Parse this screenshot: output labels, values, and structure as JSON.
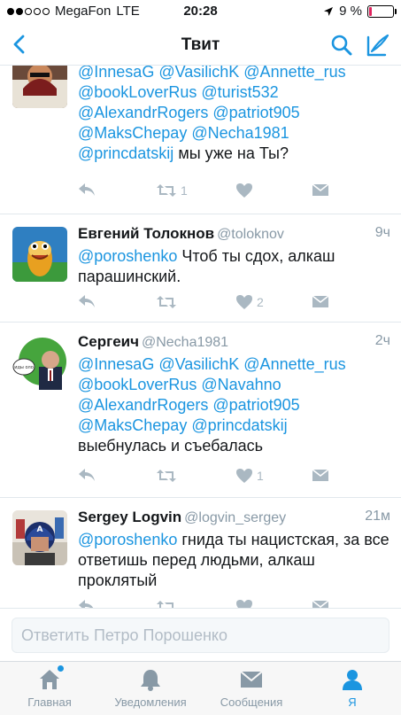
{
  "status_bar": {
    "carrier": "MegaFon",
    "network": "LTE",
    "time": "20:28",
    "battery": "9 %",
    "battery_level": 0.09,
    "signal_bars": 2
  },
  "nav": {
    "title": "Твит",
    "back_icon": "chevron-left-icon",
    "search_icon": "search-icon",
    "compose_icon": "compose-icon",
    "accent": "#1b95e0"
  },
  "tweets": [
    {
      "name": "",
      "handle": "",
      "time": "",
      "text_parts": [
        "@InnesaG @VasilichK @Annette_rus",
        "@bookLoverRus @turist532",
        "@AlexandrRogers @patriot905",
        "@MaksChepay @Necha1981",
        "@princdatskij",
        " мы уже на Ты?"
      ],
      "retweets": "1",
      "likes": ""
    },
    {
      "name": "Евгений Толокнов",
      "handle": "@toloknov",
      "time": "9ч",
      "text_parts": [
        "@poroshenko",
        " Чтоб ты сдох, алкаш парашинский."
      ],
      "retweets": "",
      "likes": "2"
    },
    {
      "name": "Сергеич",
      "handle": "@Necha1981",
      "time": "2ч",
      "text_parts": [
        "@InnesaG @VasilichK @Annette_rus",
        "@bookLoverRus @Navahno",
        "@AlexandrRogers @patriot905",
        "@MaksChepay @princdatskij",
        "выебнулась и съебалась"
      ],
      "retweets": "",
      "likes": "1"
    },
    {
      "name": "Sergey Logvin",
      "handle": "@logvin_sergey",
      "time": "21м",
      "text_parts": [
        "@poroshenko",
        " гнида ты нацистская, за все ответишь перед людьми, алкаш проклятый"
      ],
      "retweets": "",
      "likes": ""
    }
  ],
  "reply": {
    "placeholder": "Ответить Петро Порошенко"
  },
  "tabbar": {
    "items": [
      {
        "label": "Главная",
        "icon": "home-icon"
      },
      {
        "label": "Уведомления",
        "icon": "bell-icon"
      },
      {
        "label": "Сообщения",
        "icon": "envelope-icon"
      },
      {
        "label": "Я",
        "icon": "person-icon"
      }
    ],
    "active": 3
  }
}
